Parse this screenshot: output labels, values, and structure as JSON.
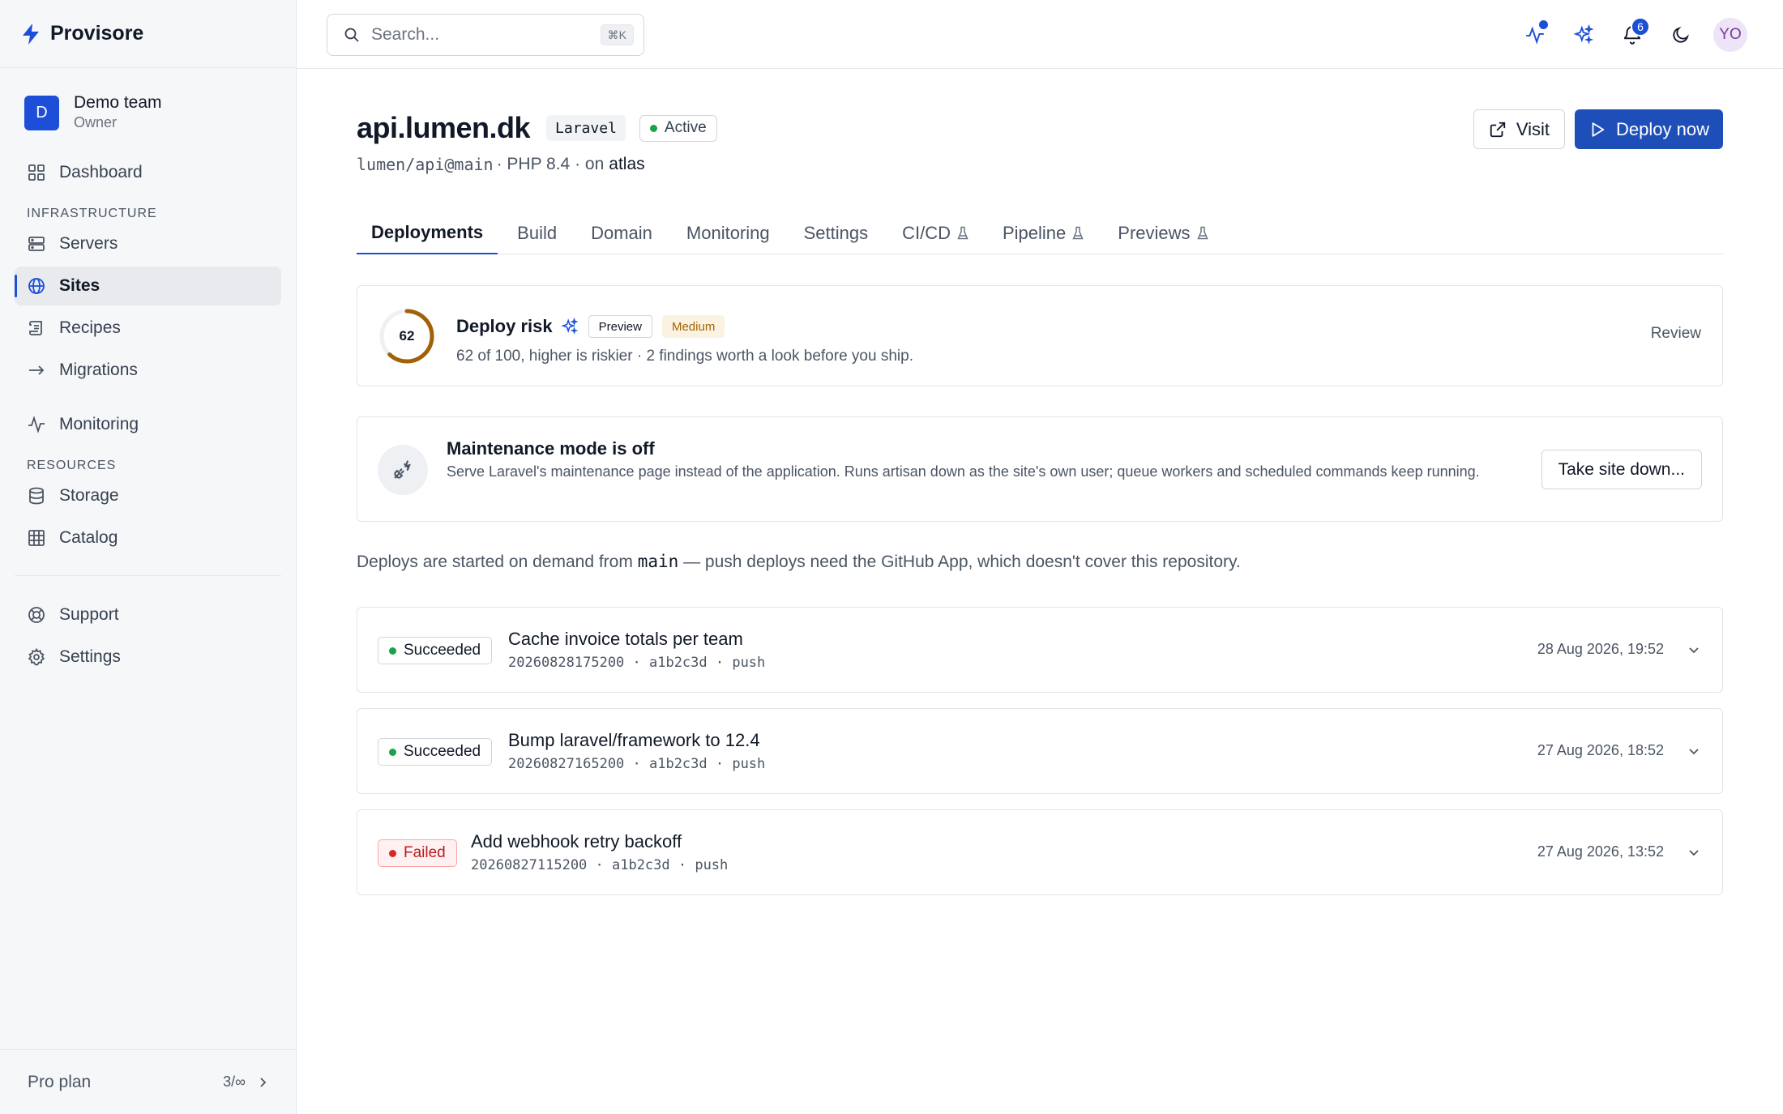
{
  "brand": {
    "name": "Provisore"
  },
  "team": {
    "initial": "D",
    "name": "Demo team",
    "role": "Owner"
  },
  "nav": {
    "dashboard": "Dashboard",
    "section_infrastructure": "INFRASTRUCTURE",
    "servers": "Servers",
    "sites": "Sites",
    "recipes": "Recipes",
    "migrations": "Migrations",
    "monitoring": "Monitoring",
    "section_resources": "RESOURCES",
    "storage": "Storage",
    "catalog": "Catalog",
    "support": "Support",
    "settings": "Settings"
  },
  "plan": {
    "name": "Pro plan",
    "usage": "3/∞"
  },
  "search": {
    "placeholder": "Search...",
    "shortcut": "⌘K"
  },
  "header": {
    "notifications_count": "6",
    "user_initials": "YO"
  },
  "site": {
    "title": "api.lumen.dk",
    "framework": "Laravel",
    "status": "Active",
    "repo": "lumen/api@main",
    "php": " · PHP 8.4 · on",
    "server": "atlas"
  },
  "actions": {
    "visit": "Visit",
    "deploy": "Deploy now"
  },
  "tabs": [
    "Deployments",
    "Build",
    "Domain",
    "Monitoring",
    "Settings",
    "CI/CD",
    "Pipeline",
    "Previews"
  ],
  "risk": {
    "score": "62",
    "score_value": 62,
    "score_max": 100,
    "title": "Deploy risk",
    "preview_chip": "Preview",
    "level": "Medium",
    "description": "62 of 100, higher is riskier · 2 findings worth a look before you ship.",
    "review": "Review"
  },
  "maintenance": {
    "title": "Maintenance mode is off",
    "description": "Serve Laravel's maintenance page instead of the application. Runs artisan down as the site's own user; queue workers and scheduled commands keep running.",
    "button": "Take site down..."
  },
  "note": {
    "before": "Deploys are started on demand from ",
    "branch": "main",
    "after": " — push deploys need the GitHub App, which doesn't cover this repository."
  },
  "deployments": [
    {
      "status": "Succeeded",
      "title": "Cache invoice totals per team",
      "meta": "20260828175200 · a1b2c3d · push",
      "time": "28 Aug 2026, 19:52"
    },
    {
      "status": "Succeeded",
      "title": "Bump laravel/framework to 12.4",
      "meta": "20260827165200 · a1b2c3d · push",
      "time": "27 Aug 2026, 18:52"
    },
    {
      "status": "Failed",
      "title": "Add webhook retry backoff",
      "meta": "20260827115200 · a1b2c3d · push",
      "time": "27 Aug 2026, 13:52"
    }
  ],
  "colors": {
    "accent": "#1d4ed8",
    "success": "#16a34a",
    "danger": "#dc2626",
    "warning": "#a16207"
  }
}
